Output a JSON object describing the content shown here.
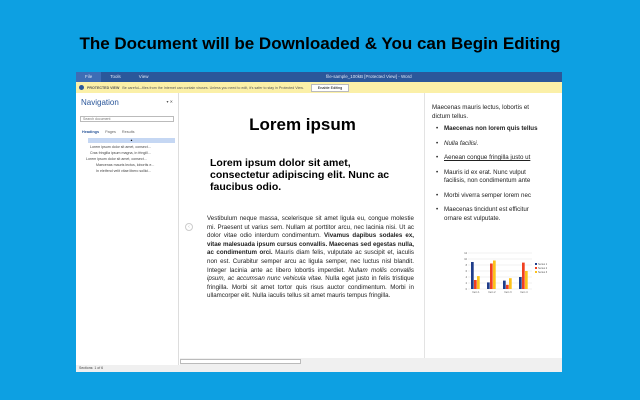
{
  "headline": "The Document will be Downloaded & You can Begin Editing",
  "titlebar": {
    "menus": [
      "File",
      "Tools",
      "View"
    ],
    "title": "file-sample_100kB [Protected View] - Word"
  },
  "protected": {
    "label": "PROTECTED VIEW",
    "message": "Be careful—files from the Internet can contain viruses. Unless you need to edit, it's safer to stay in Protected View.",
    "button": "Enable Editing"
  },
  "nav": {
    "title": "Navigation",
    "close": "▾ ✕",
    "search_placeholder": "Search document",
    "tabs": [
      "Headings",
      "Pages",
      "Results"
    ],
    "headings": [
      "Lorem ipsum dolor sit amet, consect...",
      "Cras fringilla ipsum magna, in fringill...",
      "Lorem ipsum dolor sit amet, consect...",
      "Maecenas mauris lectus, lobortis e...",
      "In eleifend velit vitae libero sollici..."
    ]
  },
  "page1": {
    "title": "Lorem ipsum",
    "subtitle": "Lorem ipsum dolor sit amet, consectetur adipiscing elit. Nunc ac faucibus odio.",
    "body": [
      {
        "t": "Vestibulum neque massa, scelerisque sit amet ligula eu, congue molestie mi. Praesent ut varius sem. Nullam at porttitor arcu, nec lacinia nisi. Ut ac dolor vitae odio interdum condimentum. ",
        "s": ""
      },
      {
        "t": "Vivamus dapibus sodales ex, vitae malesuada ipsum cursus convallis. Maecenas sed egestas nulla, ac condimentum orci.",
        "s": "b"
      },
      {
        "t": " Mauris diam felis, vulputate ac suscipit et, iaculis non est. Curabitur semper arcu ac ligula semper, nec luctus nisl blandit. Integer lacinia ante ac libero lobortis imperdiet. ",
        "s": ""
      },
      {
        "t": "Nullam mollis convallis ipsum, ac accumsan nunc vehicula vitae.",
        "s": "i"
      },
      {
        "t": " Nulla eget justo in felis tristique fringilla. Morbi sit amet tortor quis risus auctor condimentum. Morbi in ullamcorper elit. Nulla iaculis tellus sit amet mauris tempus fringilla.",
        "s": ""
      }
    ]
  },
  "page2": {
    "intro": [
      "Maecenas mauris lectus, lobortis et",
      "dictum tellus."
    ],
    "bullets": [
      {
        "t": "Maecenas non lorem quis tellus",
        "s": "b"
      },
      {
        "t": "Nulla facilisi.",
        "s": "i"
      },
      {
        "t": "Aenean congue fringilla justo ut",
        "s": "u"
      },
      {
        "t": "Mauris id ex erat. Nunc vulput|facilisis, non condimentum ante",
        "s": ""
      },
      {
        "t": "Morbi viverra semper lorem nec",
        "s": ""
      },
      {
        "t": "Maecenas tincidunt est efficitur|ornare est vulputate.",
        "s": ""
      }
    ]
  },
  "status": "Sections: 1 of 6",
  "chart_data": {
    "type": "bar",
    "categories": [
      "Item 1",
      "Item 2",
      "Item 3",
      "Item 4"
    ],
    "ylim": [
      0,
      12
    ],
    "yticks": [
      0,
      2,
      4,
      6,
      8,
      10,
      12
    ],
    "series": [
      {
        "name": "Series 1",
        "color": "#1f3d8a",
        "values": [
          9,
          2.2,
          2.8,
          4
        ]
      },
      {
        "name": "Series 2",
        "color": "#f04020",
        "values": [
          3,
          8.5,
          1.4,
          8.8
        ]
      },
      {
        "name": "Series 3",
        "color": "#fcc21a",
        "values": [
          4.3,
          9.5,
          3.6,
          6
        ]
      }
    ],
    "legend": "right",
    "grid": true
  }
}
